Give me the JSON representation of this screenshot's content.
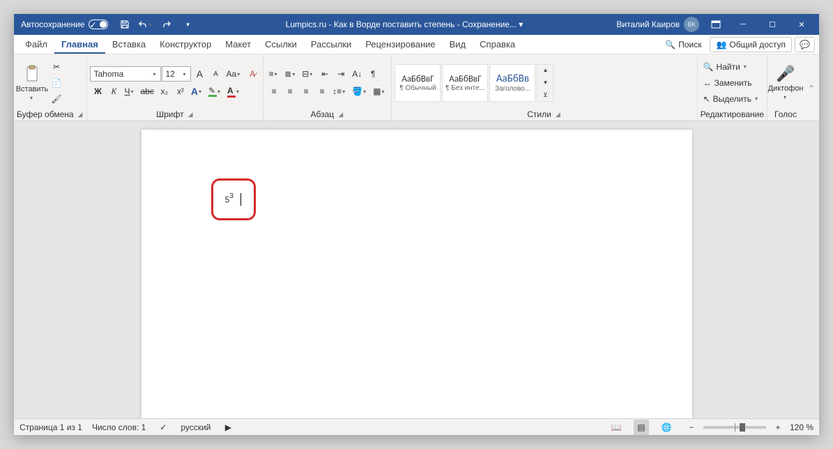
{
  "title": {
    "autosave": "Автосохранение",
    "doc": "Lumpics.ru - Как в Ворде поставить степень - Сохранение... ▾",
    "user": "Виталий Каиров",
    "initials": "ВК"
  },
  "tabs": [
    "Файл",
    "Главная",
    "Вставка",
    "Конструктор",
    "Макет",
    "Ссылки",
    "Рассылки",
    "Рецензирование",
    "Вид",
    "Справка"
  ],
  "active_tab": 1,
  "search": "Поиск",
  "share": "Общий доступ",
  "ribbon": {
    "clipboard": {
      "label": "Буфер обмена",
      "paste": "Вставить"
    },
    "font": {
      "label": "Шрифт",
      "name": "Tahoma",
      "size": "12",
      "bold": "Ж",
      "italic": "К",
      "underline": "Ч",
      "strike": "abc",
      "sub": "x₂",
      "sup": "x²",
      "grow": "A",
      "shrink": "A",
      "case": "Aa",
      "clear": "⌫"
    },
    "para": {
      "label": "Абзац"
    },
    "styles": {
      "label": "Стили",
      "items": [
        {
          "prev": "АаБбВвГ",
          "name": "¶ Обычный"
        },
        {
          "prev": "АаБбВвГ",
          "name": "¶ Без инте..."
        },
        {
          "prev": "АаБбВв",
          "name": "Заголово..."
        }
      ]
    },
    "editing": {
      "label": "Редактирование",
      "find": "Найти",
      "replace": "Заменить",
      "select": "Выделить"
    },
    "voice": {
      "label": "Голос",
      "dictate": "Диктофон"
    }
  },
  "document": {
    "base": "5",
    "exp": "3"
  },
  "status": {
    "page": "Страница 1 из 1",
    "words": "Число слов: 1",
    "lang": "русский",
    "zoom": "120 %"
  }
}
